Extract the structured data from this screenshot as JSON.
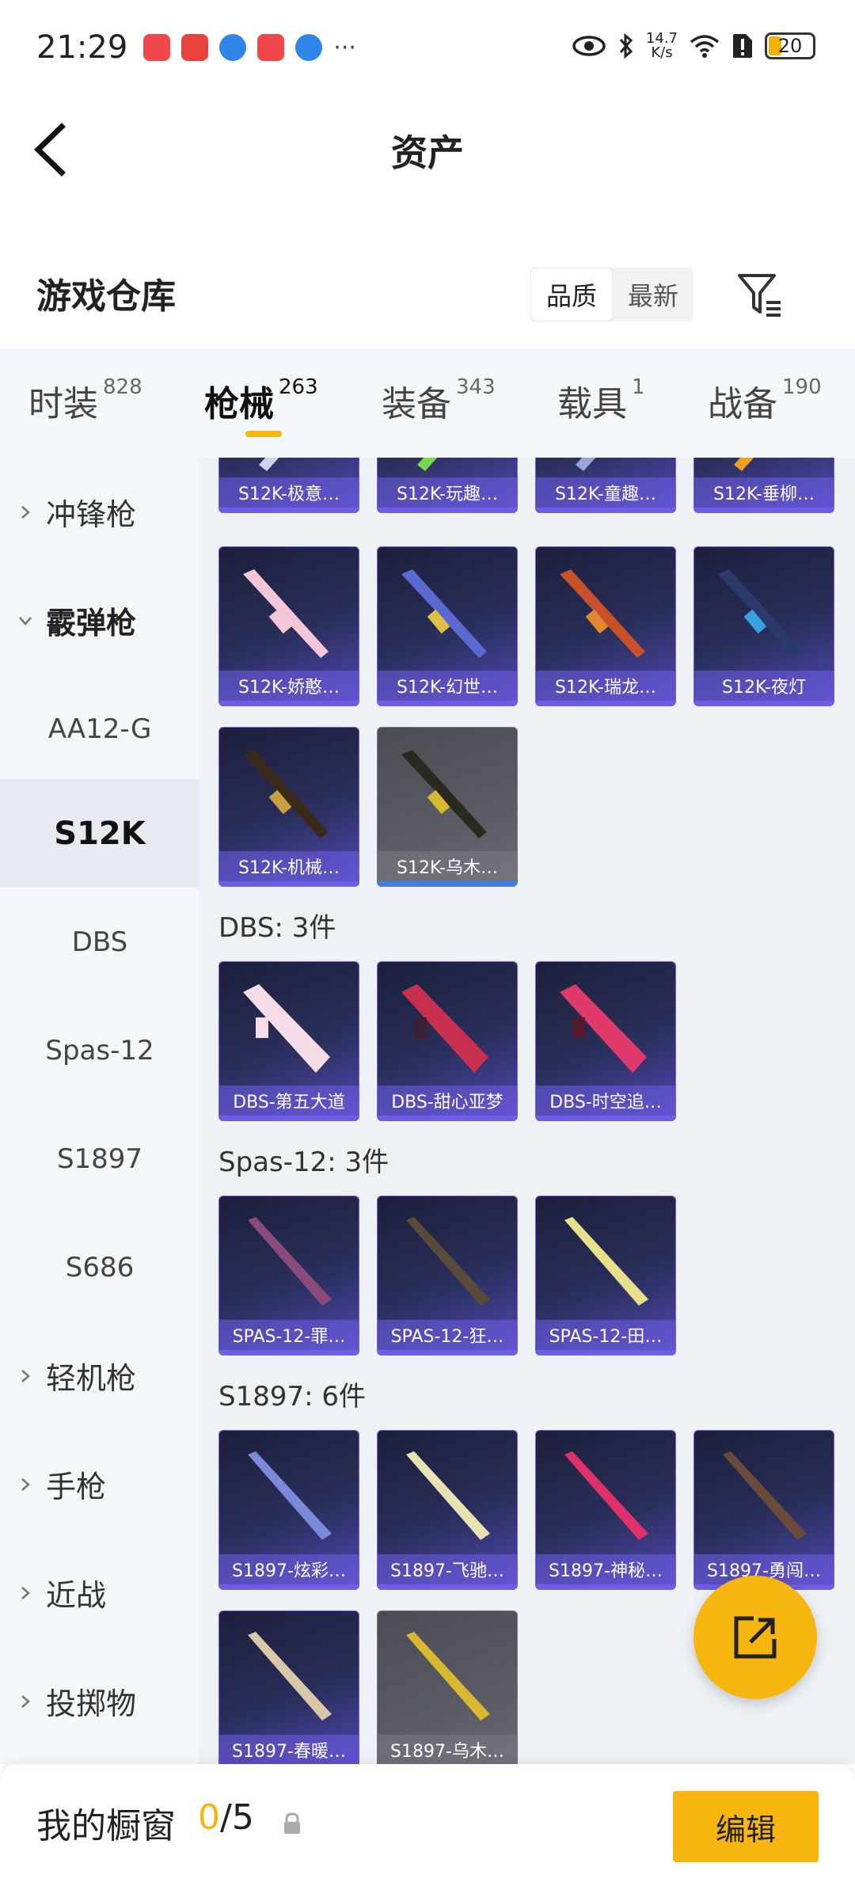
{
  "status_bar": {
    "time": "21:29",
    "net_speed_value": "14.7",
    "net_speed_unit": "K/s",
    "battery": "20",
    "more": "···"
  },
  "header": {
    "title": "资产"
  },
  "warehouse": {
    "title": "游戏仓库",
    "sort_options": [
      "品质",
      "最新"
    ]
  },
  "tabs": [
    {
      "label": "时装",
      "count": "828"
    },
    {
      "label": "枪械",
      "count": "263"
    },
    {
      "label": "装备",
      "count": "343"
    },
    {
      "label": "载具",
      "count": "1"
    },
    {
      "label": "战备",
      "count": "190"
    }
  ],
  "sidebar": [
    {
      "label": "冲锋枪"
    },
    {
      "label": "霰弹枪"
    },
    {
      "label": "AA12-G"
    },
    {
      "label": "S12K"
    },
    {
      "label": "DBS"
    },
    {
      "label": "Spas-12"
    },
    {
      "label": "S1897"
    },
    {
      "label": "S686"
    },
    {
      "label": "轻机枪"
    },
    {
      "label": "手枪"
    },
    {
      "label": "近战"
    },
    {
      "label": "投掷物"
    }
  ],
  "content": {
    "s12k_top_row": [
      "S12K-极意…",
      "S12K-玩趣…",
      "S12K-童趣…",
      "S12K-垂柳…"
    ],
    "s12k_row2": [
      "S12K-娇憨…",
      "S12K-幻世…",
      "S12K-瑞龙…",
      "S12K-夜灯"
    ],
    "s12k_row3": [
      "S12K-机械…",
      "S12K-乌木…"
    ],
    "dbs_title": "DBS: 3件",
    "dbs_items": [
      "DBS-第五大道",
      "DBS-甜心亚梦",
      "DBS-时空追…"
    ],
    "spas_title": "Spas-12: 3件",
    "spas_items": [
      "SPAS-12-罪…",
      "SPAS-12-狂…",
      "SPAS-12-田…"
    ],
    "s1897_title": "S1897: 6件",
    "s1897_row1": [
      "S1897-炫彩…",
      "S1897-飞驰…",
      "S1897-神秘…",
      "S1897-勇闯…"
    ],
    "s1897_row2": [
      "S1897-春暖…",
      "S1897-乌木…"
    ]
  },
  "bottom_bar": {
    "label": "我的橱窗",
    "count_current": "0",
    "count_total": "/5",
    "edit_label": "编辑"
  },
  "colors": {
    "accent": "#f7b50f",
    "card_purple": "#5248b8",
    "sidebar_bg": "#f4f7fb",
    "content_bg": "#eef1f6"
  }
}
